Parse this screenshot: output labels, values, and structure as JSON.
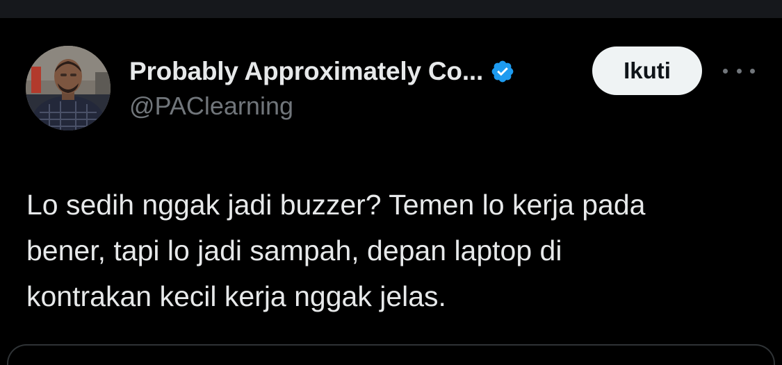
{
  "tweet": {
    "author": {
      "display_name": "Probably Approximately Co...",
      "handle": "@PAClearning",
      "verified": true,
      "avatar_icon": "user-photo-avatar"
    },
    "follow_label": "Ikuti",
    "more_icon": "more-horizontal-icon",
    "text_lines": [
      "Lo sedih nggak jadi buzzer? Temen lo kerja pada",
      "bener, tapi lo jadi sampah, depan laptop di",
      "kontrakan kecil kerja nggak jelas."
    ]
  },
  "colors": {
    "background": "#000000",
    "text_primary": "#e7e9ea",
    "text_secondary": "#71767b",
    "verified_badge": "#1d9bf0",
    "follow_button_bg": "#eff3f4",
    "follow_button_text": "#0f1419"
  }
}
